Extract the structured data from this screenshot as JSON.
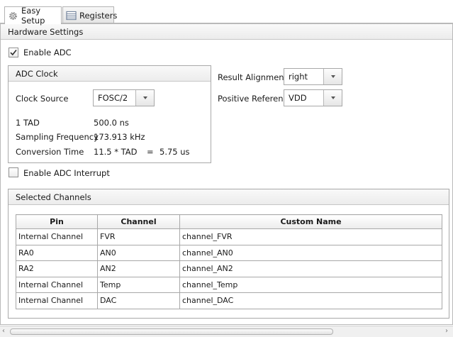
{
  "tabs": [
    {
      "label": "Easy Setup",
      "icon": "gear-icon",
      "active": true
    },
    {
      "label": "Registers",
      "icon": "registers-icon",
      "active": false
    }
  ],
  "hardware_settings": {
    "title": "Hardware Settings",
    "enable_adc": {
      "label": "Enable ADC",
      "checked": true
    },
    "adc_clock": {
      "title": "ADC Clock",
      "clock_source_label": "Clock Source",
      "clock_source_value": "FOSC/2",
      "tad_label": "1 TAD",
      "tad_value": "500.0 ns",
      "sampling_label": "Sampling Frequency",
      "sampling_value": "173.913 kHz",
      "conversion_label": "Conversion Time",
      "conversion_formula": "11.5 * TAD",
      "conversion_eq": "=",
      "conversion_value": "5.75 us"
    },
    "result_alignment": {
      "label": "Result Alignment",
      "value": "right"
    },
    "positive_reference": {
      "label": "Positive Reference",
      "value": "VDD"
    },
    "enable_interrupt": {
      "label": "Enable ADC Interrupt",
      "checked": false
    }
  },
  "selected_channels": {
    "title": "Selected Channels",
    "columns": [
      "Pin",
      "Channel",
      "Custom Name"
    ],
    "rows": [
      [
        "Internal Channel",
        "FVR",
        "channel_FVR"
      ],
      [
        "RA0",
        "AN0",
        "channel_AN0"
      ],
      [
        "RA2",
        "AN2",
        "channel_AN2"
      ],
      [
        "Internal Channel",
        "Temp",
        "channel_Temp"
      ],
      [
        "Internal Channel",
        "DAC",
        "channel_DAC"
      ]
    ]
  },
  "colors": {
    "border": "#b9b9b9",
    "header_bg": "#ececec"
  }
}
